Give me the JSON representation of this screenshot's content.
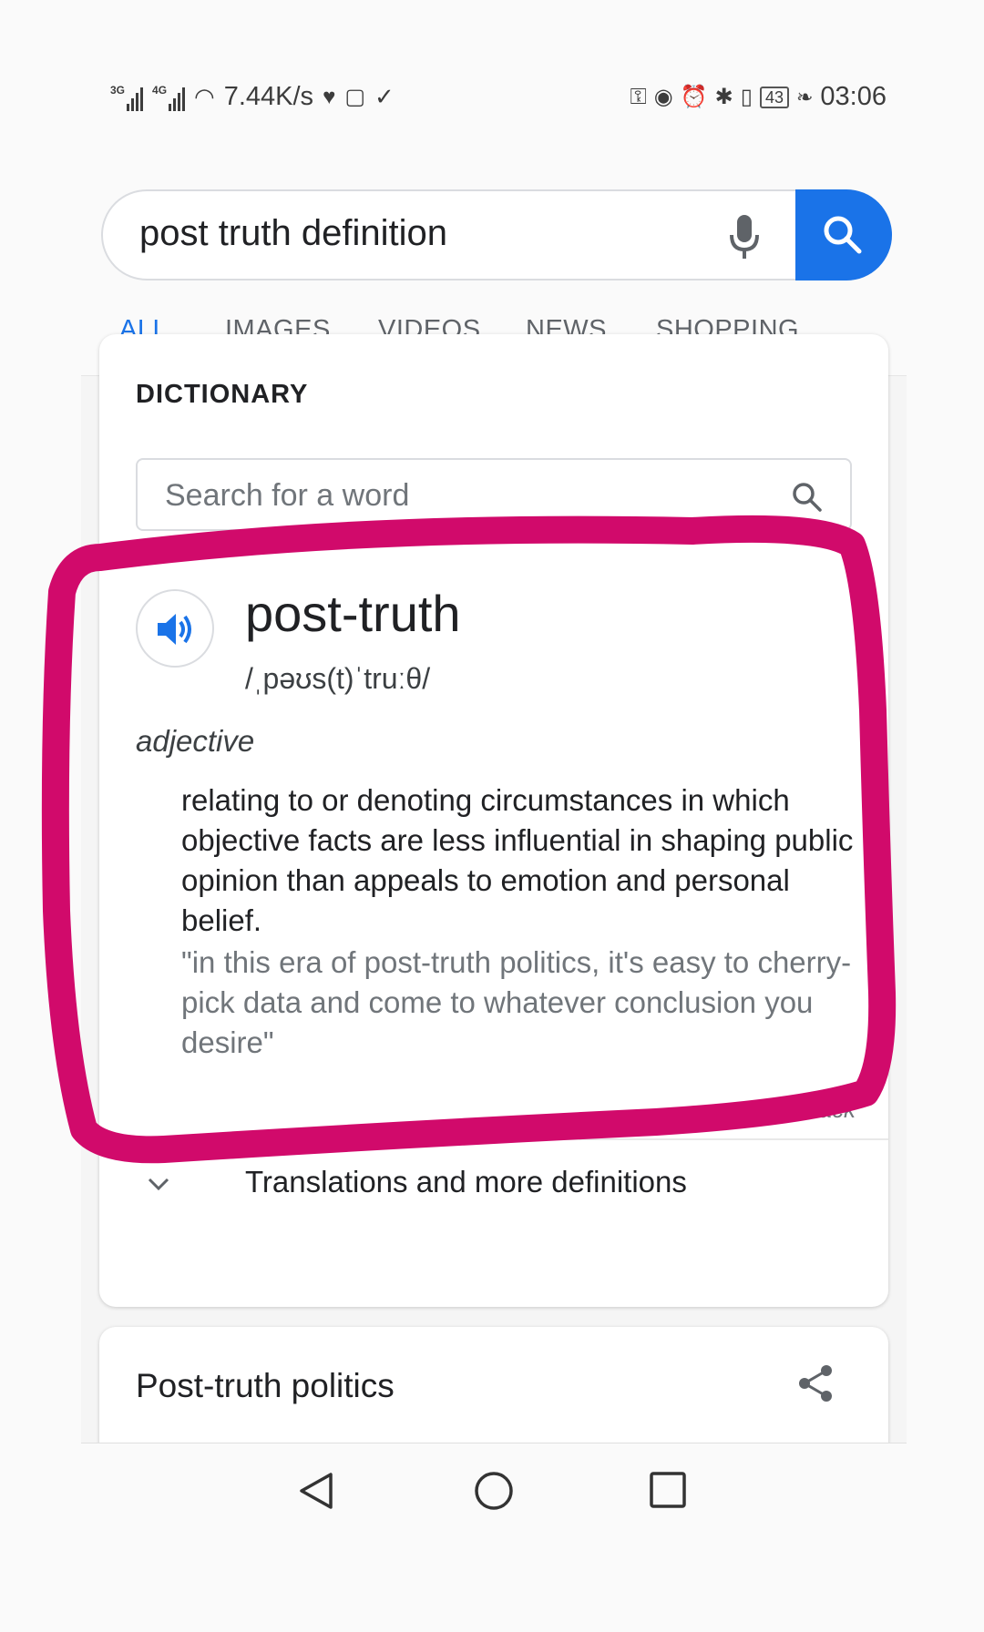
{
  "status_bar": {
    "network_left": "3G",
    "network_right": "4G",
    "speed": "7.44K/s",
    "battery": "43",
    "time": "03:06"
  },
  "search": {
    "query": "post truth definition"
  },
  "tabs": [
    "ALL",
    "IMAGES",
    "VIDEOS",
    "NEWS",
    "SHOPPING"
  ],
  "active_tab": "ALL",
  "dictionary": {
    "label": "DICTIONARY",
    "search_placeholder": "Search for a word",
    "word": "post-truth",
    "phonetic": "/ˌpəʊs(t)ˈtruːθ/",
    "part_of_speech": "adjective",
    "definition": "relating to or denoting circumstances in which objective facts are less influential in shaping public opinion than appeals to emotion and personal belief.",
    "example": "\"in this era of post-truth politics, it's easy to cherry-pick data and come to whatever conclusion you desire\"",
    "feedback": "Feedback",
    "more": "Translations and more definitions"
  },
  "next_card": {
    "title": "Post-truth politics"
  },
  "colors": {
    "accent": "#1a73e8",
    "highlight": "#d10a6b"
  }
}
